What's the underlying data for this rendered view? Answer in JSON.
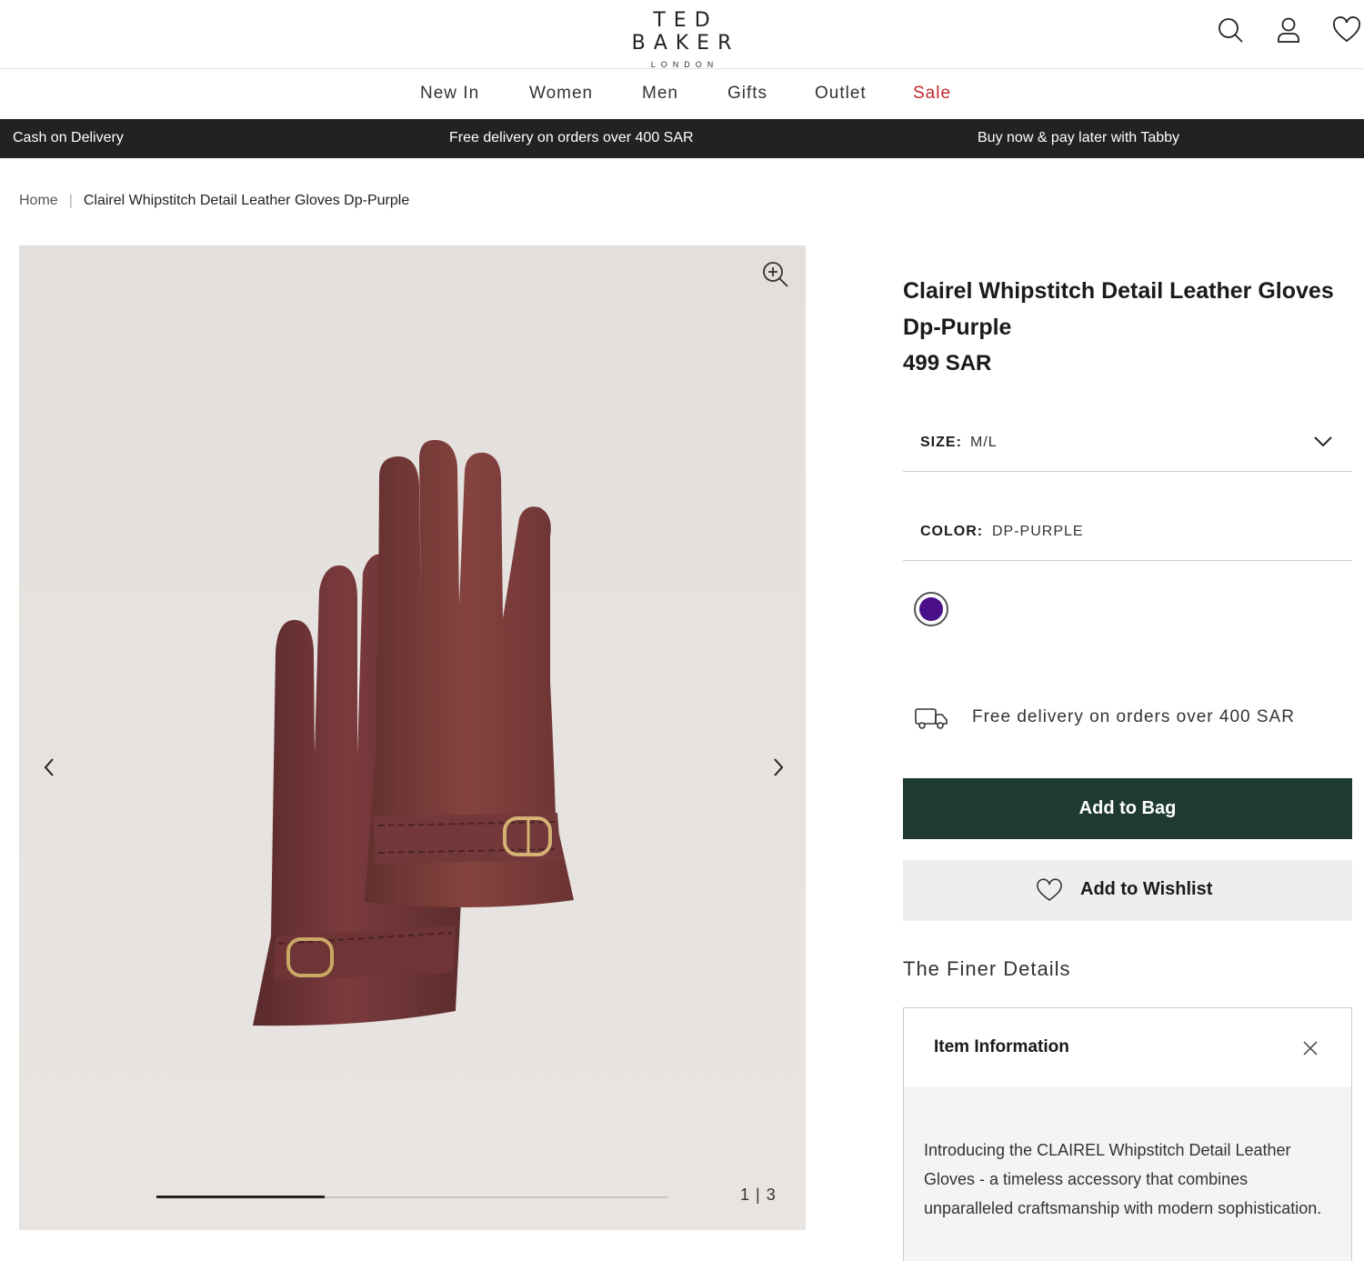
{
  "header": {
    "brand": "TED BAKER",
    "brand_sub": "LONDON",
    "icons": [
      "search-icon",
      "account-icon",
      "wishlist-icon"
    ]
  },
  "nav": {
    "items": [
      {
        "label": "New In"
      },
      {
        "label": "Women"
      },
      {
        "label": "Men"
      },
      {
        "label": "Gifts"
      },
      {
        "label": "Outlet"
      },
      {
        "label": "Sale"
      }
    ],
    "sale_color": "#c0272d"
  },
  "promo": {
    "left": "Cash on Delivery",
    "center": "Free delivery on orders over 400 SAR",
    "right": "Buy now & pay later with Tabby"
  },
  "breadcrumb": {
    "home": "Home",
    "current": "Clairel Whipstitch Detail Leather Gloves Dp-Purple"
  },
  "gallery": {
    "current": "1",
    "divider": "|",
    "total": "3",
    "progress": 0.33
  },
  "product": {
    "title": "Clairel Whipstitch Detail Leather Gloves Dp-Purple",
    "price": "499 SAR",
    "size_label": "SIZE:",
    "size_value": "M/L",
    "color_label": "COLOR:",
    "color_value": "DP-PURPLE",
    "swatch_color": "#4b0f8a",
    "delivery_text": "Free delivery on orders over 400 SAR",
    "add_to_bag": "Add to Bag",
    "add_to_wishlist": "Add to Wishlist",
    "button_color": "#1f3a2f"
  },
  "details": {
    "heading": "The Finer Details",
    "accordion_title": "Item Information",
    "description": "Introducing the CLAIREL Whipstitch Detail Leather Gloves - a timeless accessory that combines unparalleled craftsmanship with modern sophistication."
  }
}
